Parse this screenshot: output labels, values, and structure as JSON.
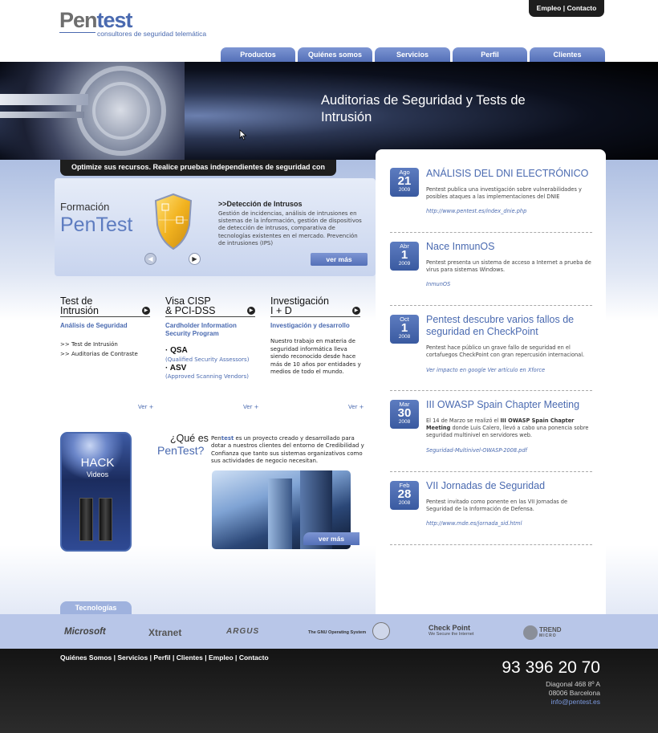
{
  "logo": {
    "part1": "Pen",
    "part2": "test",
    "tagline": "consultores de seguridad telemática"
  },
  "top_links": {
    "empleo": "Empleo",
    "separator": "|",
    "contacto": "Contacto"
  },
  "nav": [
    "Productos",
    "Quiénes somos",
    "Servicios",
    "Perfil",
    "Clientes"
  ],
  "banner": {
    "title": "Auditorias de Seguridad y Tests de Intrusión"
  },
  "optimize_bar": "Optimize sus recursos. Realice pruebas independientes de seguridad con Pentest!",
  "promo": {
    "formacion": "Formación",
    "pentest": "PenTest",
    "prev_icon": "arrow-left-icon",
    "next_icon": "arrow-right-icon",
    "title": ">>Detección de Intrusos",
    "text": "Gestión de incidencias, análisis de intrusiones en sistemas de la información, gestión de dispositivos de detección de intrusos, comparativa de tecnologías existentes en el mercado. Prevención de intrusiones (IPS)",
    "ver_mas": "ver más"
  },
  "columns": [
    {
      "title_line1": "Test de",
      "title_line2": "Intrusión",
      "subtitle": "Análisis de Seguridad",
      "links": [
        ">> Test de Intrusión",
        ">> Auditorias de Contraste"
      ],
      "ver": "Ver +"
    },
    {
      "title_line1": "Visa CISP",
      "title_line2": "& PCI-DSS",
      "subtitle_line1": "Cardholder Information",
      "subtitle_line2": "Security Program",
      "qsa": "· QSA",
      "qsa_sub": "(Qualified Security Assessors)",
      "asv": "· ASV",
      "asv_sub": "(Approved Scanning Vendors)",
      "ver": "Ver +"
    },
    {
      "title_line1": "Investigación",
      "title_line2": "I + D",
      "subtitle": "Investigación y desarrollo",
      "text": "Nuestro trabajo en materia de seguridad informática lleva siendo reconocido desde hace más de 10 años por entidades y medios de todo el mundo.",
      "ver": "Ver +"
    }
  ],
  "hack": {
    "line1": "HACK",
    "line2": "Videos"
  },
  "que_es": {
    "line1": "¿Qué es",
    "line2": "PenTest?",
    "brand_a": "Pen",
    "brand_b": "test",
    "text": " es un proyecto creado y desarrollado para dotar a nuestros clientes del entorno de Credibilidad y Confianza que tanto sus sistemas organizativos como sus actividades de negocio necesitan.",
    "ver_mas": "ver más"
  },
  "news": [
    {
      "month": "Ago",
      "day": "21",
      "year": "2009",
      "title": "ANÁLISIS DEL DNI ELECTRÓNICO",
      "body": "Pentest publica una investigación sobre vulnerabilidades y posibles ataques a las implementaciones del DNIE",
      "link": "http://www.pentest.es/index_dnie.php"
    },
    {
      "month": "Abr",
      "day": "1",
      "year": "2009",
      "title": "Nace InmunOS",
      "body": "Pentest presenta un sistema de acceso a Internet a prueba de virus para sistemas Windows.",
      "link": "InmunOS"
    },
    {
      "month": "Oct",
      "day": "1",
      "year": "2008",
      "title": "Pentest descubre varios fallos de seguridad en CheckPoint",
      "body": "Pentest hace público un grave fallo de seguridad en el cortafuegos CheckPoint con gran repercusión internacional.",
      "link": "Ver impacto en google Ver artículo en Xforce"
    },
    {
      "month": "Mar",
      "day": "30",
      "year": "2008",
      "title": "III OWASP Spain Chapter Meeting",
      "body_a": "El 14 de Marzo se realizó el ",
      "body_b": "III OWASP Spain Chapter Meeting",
      "body_c": " donde Luis Calero, llevó a cabo una ponencia sobre seguridad multinivel en servidores web.",
      "link": "Seguridad-Multinivel-OWASP-2008.pdf"
    },
    {
      "month": "Feb",
      "day": "28",
      "year": "2008",
      "title": "VII Jornadas de Seguridad",
      "body": "Pentest invitado como ponente en las VII Jornadas de Seguridad de la Información de Defensa.",
      "link": "http://www.mde.es/jornada_sid.html"
    }
  ],
  "tecnologias": {
    "tab": "Tecnologías",
    "logos": [
      "Microsoft",
      "Xtranet",
      "ARGUS",
      "The GNU Operating System",
      "Check Point",
      "TREND"
    ],
    "checkpoint_sub": "We Secure the Internet",
    "trend_sub": "MICRO"
  },
  "footer": {
    "links": [
      "Quiénes Somos",
      "Servicios",
      "Perfil",
      "Clientes",
      "Empleo",
      "Contacto"
    ],
    "separator": "|",
    "phone": "93 396 20 70",
    "address1": "Diagonal 468 8º A",
    "address2": "08006 Barcelona",
    "email": "info@pentest.es"
  }
}
